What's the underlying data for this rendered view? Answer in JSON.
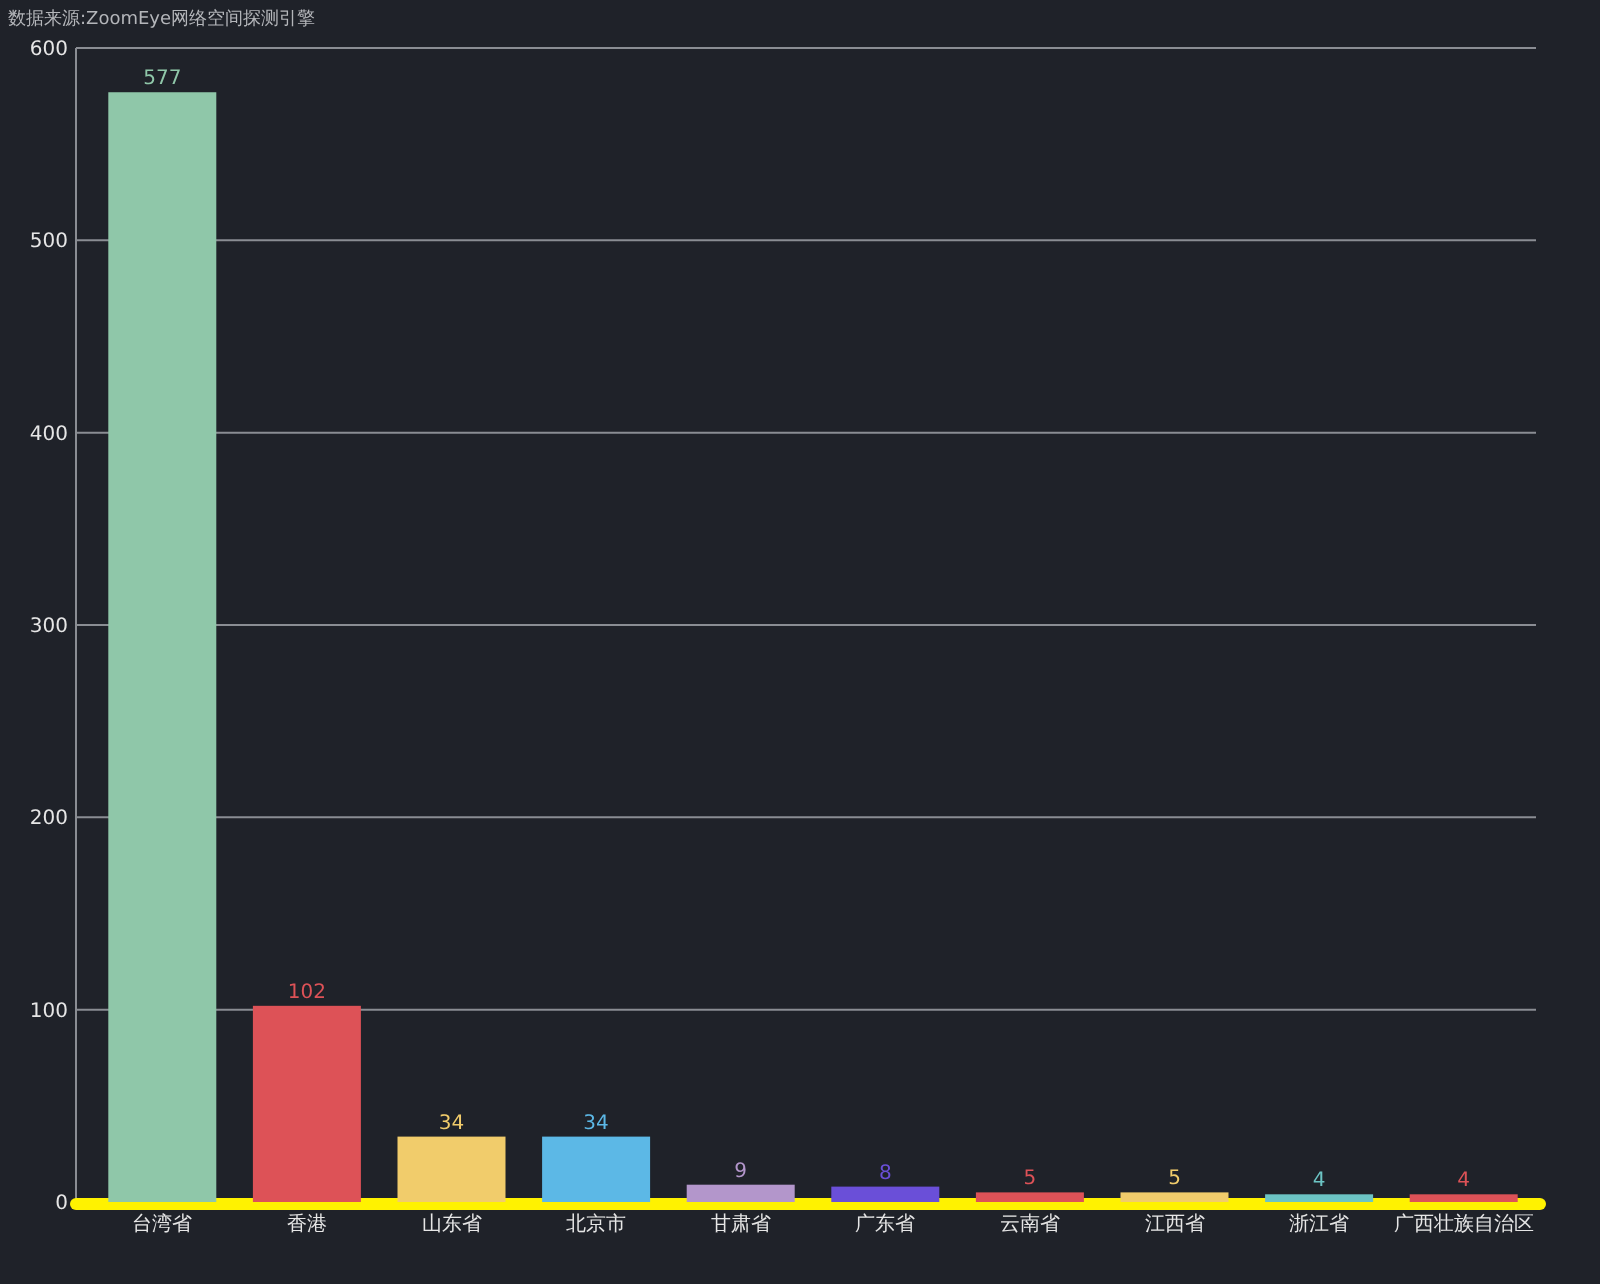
{
  "chart": {
    "chart_data": {
      "type": "bar",
      "title": "数据来源:ZoomEye网络空间探测引擎",
      "categories": [
        "台湾省",
        "香港",
        "山东省",
        "北京市",
        "甘肃省",
        "广东省",
        "云南省",
        "江西省",
        "浙江省",
        "广西壮族自治区"
      ],
      "series": [
        {
          "colors": [
            "#8fc7a9",
            "#dd5257",
            "#f1cc6b",
            "#5cb8e6",
            "#b396cb",
            "#6a4fd8",
            "#dd5257",
            "#f1cc6b",
            "#6cc4c4",
            "#dd5257"
          ],
          "values": [
            577,
            102,
            34,
            34,
            9,
            8,
            5,
            5,
            4,
            4
          ]
        }
      ],
      "ylim": [
        0,
        600
      ],
      "grid": true,
      "yticks": [
        0,
        100,
        200,
        300,
        400,
        500,
        600
      ],
      "data_labels": true
    }
  }
}
